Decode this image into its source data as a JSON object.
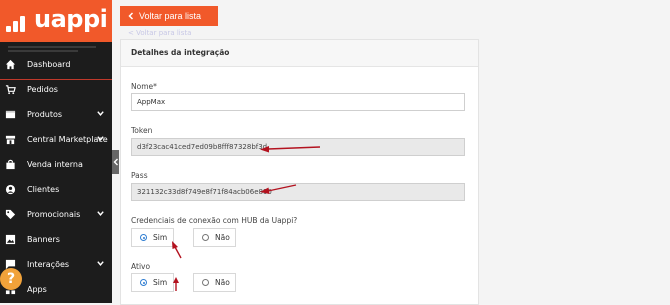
{
  "brand": {
    "name": "uappi",
    "color": "#f1592a"
  },
  "sidebar": {
    "items": [
      {
        "label": "Dashboard",
        "icon": "home-icon",
        "chevron": false
      },
      {
        "label": "Pedidos",
        "icon": "cart-icon",
        "chevron": false
      },
      {
        "label": "Produtos",
        "icon": "box-icon",
        "chevron": true
      },
      {
        "label": "Central Marketplace",
        "icon": "store-icon",
        "chevron": true
      },
      {
        "label": "Venda interna",
        "icon": "bag-icon",
        "chevron": false
      },
      {
        "label": "Clientes",
        "icon": "user-icon",
        "chevron": false
      },
      {
        "label": "Promocionais",
        "icon": "tag-icon",
        "chevron": true
      },
      {
        "label": "Banners",
        "icon": "image-icon",
        "chevron": false
      },
      {
        "label": "Interações",
        "icon": "chat-icon",
        "chevron": true
      },
      {
        "label": "Apps",
        "icon": "apps-icon",
        "chevron": false
      }
    ],
    "help_label": "?"
  },
  "toolbar": {
    "back_label": "Voltar para lista"
  },
  "panel": {
    "title": "Detalhes da integração",
    "name_label": "Nome*",
    "name_value": "AppMax",
    "token_label": "Token",
    "token_value": "d3f23cac41ced7ed09b8fff87328bf3d",
    "pass_label": "Pass",
    "pass_value": "321132c33d8f749e8f71f84acb06e890",
    "hub_label": "Credenciais de conexão com HUB da Uappi?",
    "hub_yes": "Sim",
    "hub_no": "Não",
    "active_label": "Ativo",
    "active_yes": "Sim",
    "active_no": "Não"
  },
  "colors": {
    "accent": "#f1592a",
    "radio": "#2f7dd1",
    "annotation": "#b3121f"
  }
}
